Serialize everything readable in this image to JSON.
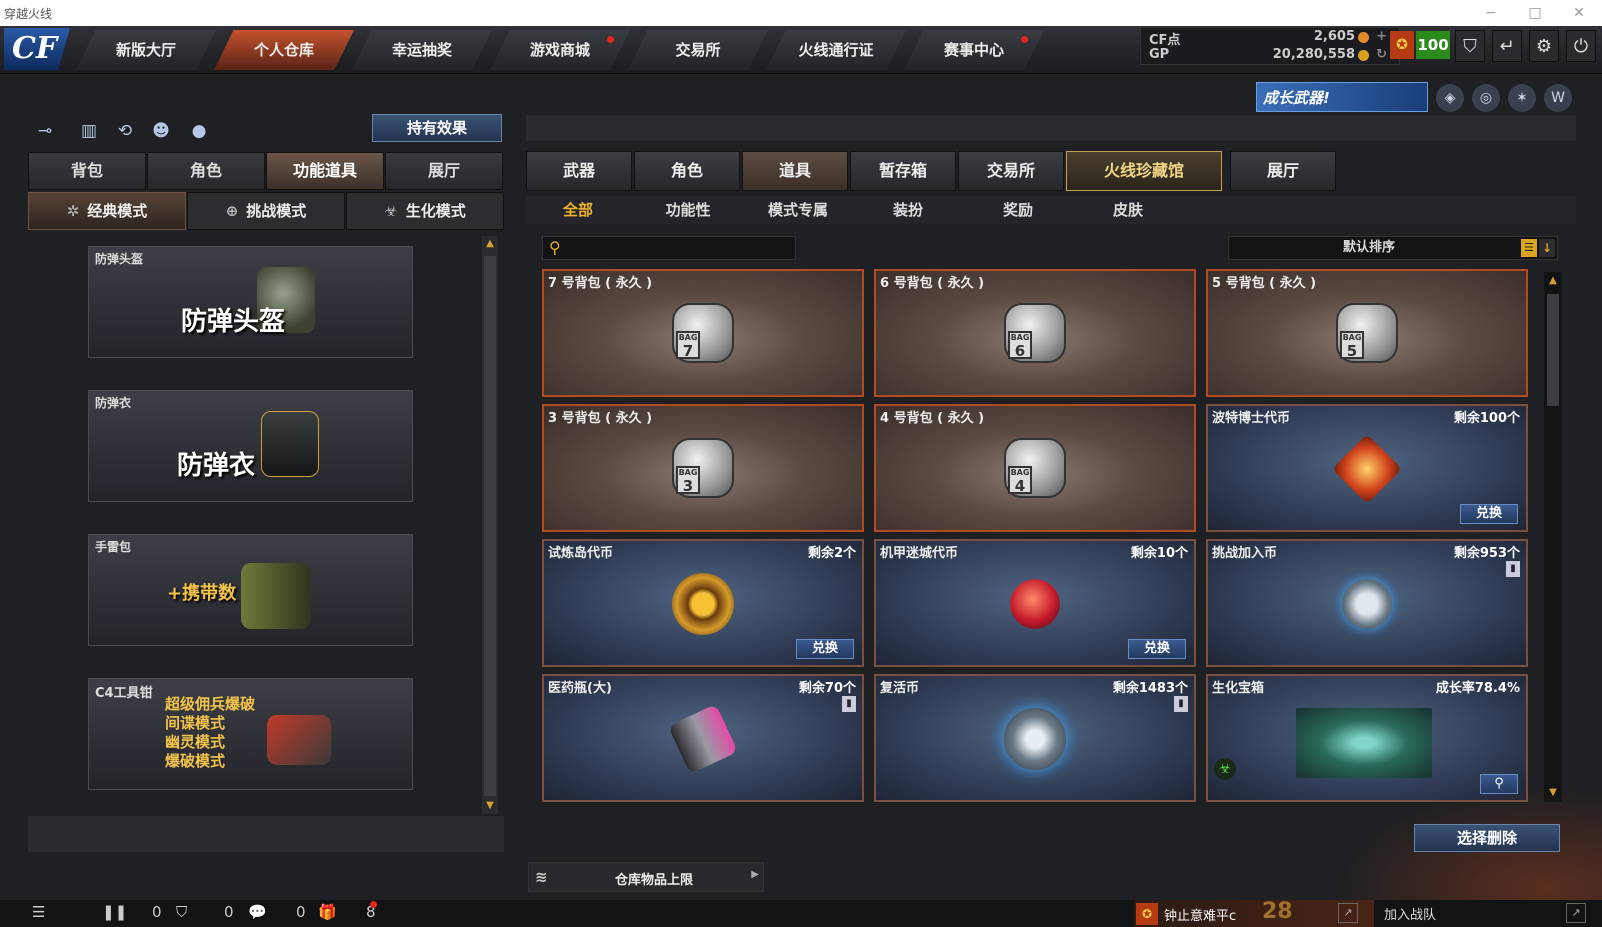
{
  "window": {
    "title": "穿越火线"
  },
  "nav": {
    "logo": "CF",
    "tabs": [
      {
        "label": "新版大厅",
        "active": false,
        "dot": false
      },
      {
        "label": "个人仓库",
        "active": true,
        "dot": false
      },
      {
        "label": "幸运抽奖",
        "active": false,
        "dot": false
      },
      {
        "label": "游戏商城",
        "active": false,
        "dot": true
      },
      {
        "label": "交易所",
        "active": false,
        "dot": false
      },
      {
        "label": "火线通行证",
        "active": false,
        "dot": false
      },
      {
        "label": "赛事中心",
        "active": false,
        "dot": true
      }
    ]
  },
  "currency": {
    "cf_label": "CF点",
    "cf_value": "2,605",
    "gp_label": "GP",
    "gp_value": "20,280,558"
  },
  "player": {
    "level": "100"
  },
  "banner": {
    "text": "成长武器!"
  },
  "left": {
    "hold_effect_label": "持有效果",
    "tabs": [
      "背包",
      "角色",
      "功能道具",
      "展厅"
    ],
    "active_tab": 2,
    "modes": [
      "经典模式",
      "挑战模式",
      "生化模式"
    ],
    "items": [
      {
        "tag": "防弹头盔",
        "title": "防弹头盔"
      },
      {
        "tag": "防弹衣",
        "title": "防弹衣"
      },
      {
        "tag": "手雷包",
        "title": "+携带数"
      },
      {
        "tag": "C4工具钳",
        "lines": [
          "超级佣兵爆破",
          "间谍模式",
          "幽灵模式",
          "爆破模式"
        ]
      }
    ]
  },
  "right": {
    "tabs": [
      "武器",
      "角色",
      "道具",
      "暂存箱",
      "交易所",
      "火线珍藏馆",
      "展厅"
    ],
    "active_tab": 2,
    "subtabs": [
      "全部",
      "功能性",
      "模式专属",
      "装扮",
      "奖励",
      "皮肤"
    ],
    "active_subtab": 0,
    "search_placeholder": "",
    "sort_label": "默认排序",
    "cards": [
      {
        "name": "7 号背包 ( 永久 )",
        "bag": "7"
      },
      {
        "name": "6 号背包 ( 永久 )",
        "bag": "6"
      },
      {
        "name": "5 号背包 ( 永久 )",
        "bag": "5"
      },
      {
        "name": "3 号背包 ( 永久 )",
        "bag": "3"
      },
      {
        "name": "4 号背包 ( 永久 )",
        "bag": "4"
      },
      {
        "name": "波特博士代币",
        "remain": "剩余100个",
        "action": "兑换"
      },
      {
        "name": "试炼岛代币",
        "remain": "剩余2个",
        "action": "兑换"
      },
      {
        "name": "机甲迷城代币",
        "remain": "剩余10个",
        "action": "兑换"
      },
      {
        "name": "挑战加入币",
        "remain": "剩余953个"
      },
      {
        "name": "医药瓶(大)",
        "remain": "剩余70个"
      },
      {
        "name": "复活币",
        "remain": "剩余1483个"
      },
      {
        "name": "生化宝箱",
        "remain": "成长率78.4%"
      }
    ],
    "delete_label": "选择删除",
    "capacity_label": "仓库物品上限"
  },
  "status": {
    "counts": [
      "0",
      "0",
      "0",
      "8"
    ],
    "clan_text": "钟止意难平c",
    "clan_num": "28",
    "join_label": "加入战队"
  },
  "colors": {
    "accent": "#c6522e",
    "gold": "#f0b428",
    "card_border": "#b24a22",
    "blue_btn": "#3b5a8e"
  }
}
